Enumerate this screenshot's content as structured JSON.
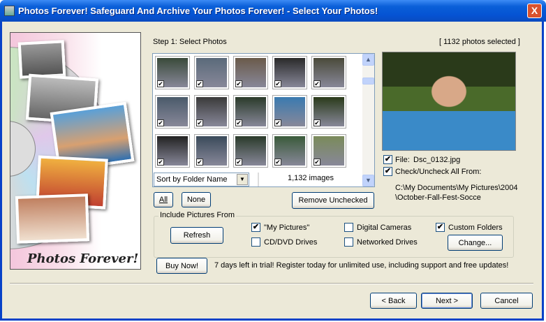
{
  "window": {
    "title": "Photos Forever!  Safeguard And Archive Your Photos Forever! - Select Your Photos!",
    "close": "X"
  },
  "art": {
    "logo_text": "Photos Forever!"
  },
  "step_label": "Step 1:  Select Photos",
  "selected_count": "[ 1132 photos selected ]",
  "thumbnails": [
    {
      "color": "#3a4a3a",
      "checked": true
    },
    {
      "color": "#5a6a7a",
      "checked": true
    },
    {
      "color": "#6a5a4a",
      "checked": true
    },
    {
      "color": "#2a2a2a",
      "checked": true
    },
    {
      "color": "#4a4a3a",
      "checked": true
    },
    {
      "color": "#4a5a6a",
      "checked": true
    },
    {
      "color": "#3a3a3a",
      "checked": true
    },
    {
      "color": "#2a3a2a",
      "checked": true
    },
    {
      "color": "#3a7ab0",
      "checked": true
    },
    {
      "color": "#2a3a1a",
      "checked": true
    },
    {
      "color": "#222222",
      "checked": true
    },
    {
      "color": "#3a4a5a",
      "checked": true
    },
    {
      "color": "#2a3a2a",
      "checked": true
    },
    {
      "color": "#3a5a3a",
      "checked": true
    },
    {
      "color": "#7a8a5a",
      "checked": true
    }
  ],
  "sort": {
    "selected": "Sort by Folder Name"
  },
  "image_count": "1,132 images",
  "buttons": {
    "all": "All",
    "none": "None",
    "remove_unchecked": "Remove Unchecked",
    "refresh": "Refresh",
    "change": "Change...",
    "buy_now": "Buy Now!",
    "back": "< Back",
    "next": "Next >",
    "cancel": "Cancel"
  },
  "preview": {
    "file_label": "File:",
    "file_name": "Dsc_0132.jpg",
    "check_all_label": "Check/Uncheck All From:",
    "path": "C:\\My Documents\\My Pictures\\2004\\October-Fall-Fest-Socce"
  },
  "include": {
    "title": "Include Pictures From",
    "options": [
      {
        "label": "\"My Pictures\"",
        "checked": true
      },
      {
        "label": "CD/DVD Drives",
        "checked": false
      },
      {
        "label": "Digital Cameras",
        "checked": false
      },
      {
        "label": "Networked Drives",
        "checked": false
      },
      {
        "label": "Custom Folders",
        "checked": true
      }
    ]
  },
  "trial_text": "7 days left in trial!  Register today for unlimited use, including support and free updates!"
}
